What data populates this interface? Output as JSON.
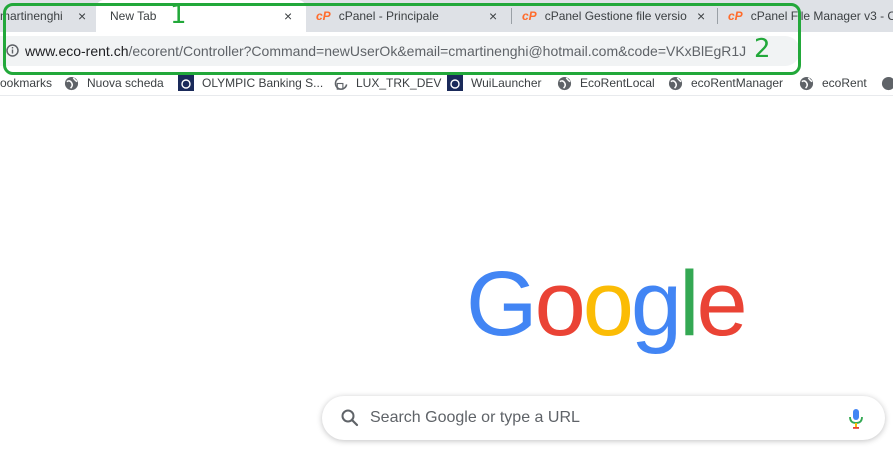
{
  "tabs": [
    {
      "title": "martinenghi -",
      "active": false,
      "icon": "none"
    },
    {
      "title": "New Tab",
      "active": true,
      "icon": "none"
    },
    {
      "title": "cPanel - Principale",
      "active": false,
      "icon": "cpanel-icon"
    },
    {
      "title": "cPanel Gestione file version",
      "active": false,
      "icon": "cpanel-icon"
    },
    {
      "title": "cPanel File Manager v3 - C",
      "active": false,
      "icon": "cpanel-icon"
    }
  ],
  "tab_close_glyph": "×",
  "tab_icon_text": "cP",
  "address_bar": {
    "host": "www.eco-rent.ch",
    "path": "/ecorent/Controller?Command=newUserOk&email=cmartinenghi@hotmail.com&code=VKxBlEgR1J"
  },
  "bookmarks": [
    {
      "label": "ookmarks",
      "icon": "none"
    },
    {
      "label": "Nuova scheda",
      "icon": "globe-icon"
    },
    {
      "label": "OLYMPIC Banking S...",
      "icon": "olympic-icon"
    },
    {
      "label": "LUX_TRK_DEV",
      "icon": "loading-icon"
    },
    {
      "label": "WuiLauncher",
      "icon": "olympic-icon"
    },
    {
      "label": "EcoRentLocal",
      "icon": "globe-icon"
    },
    {
      "label": "ecoRentManager",
      "icon": "globe-icon"
    },
    {
      "label": "ecoRent",
      "icon": "globe-icon"
    }
  ],
  "annotations": [
    "1",
    "2"
  ],
  "logo": {
    "letters": [
      "G",
      "o",
      "o",
      "g",
      "l",
      "e"
    ],
    "colors": [
      "#4285F4",
      "#EA4335",
      "#FBBC05",
      "#4285F4",
      "#34A853",
      "#EA4335"
    ]
  },
  "search": {
    "placeholder": "Search Google or type a URL"
  },
  "colors": {
    "annotation": "#22a83a",
    "cpanel": "#ff6c2c",
    "tabstrip": "#dee1e6"
  }
}
